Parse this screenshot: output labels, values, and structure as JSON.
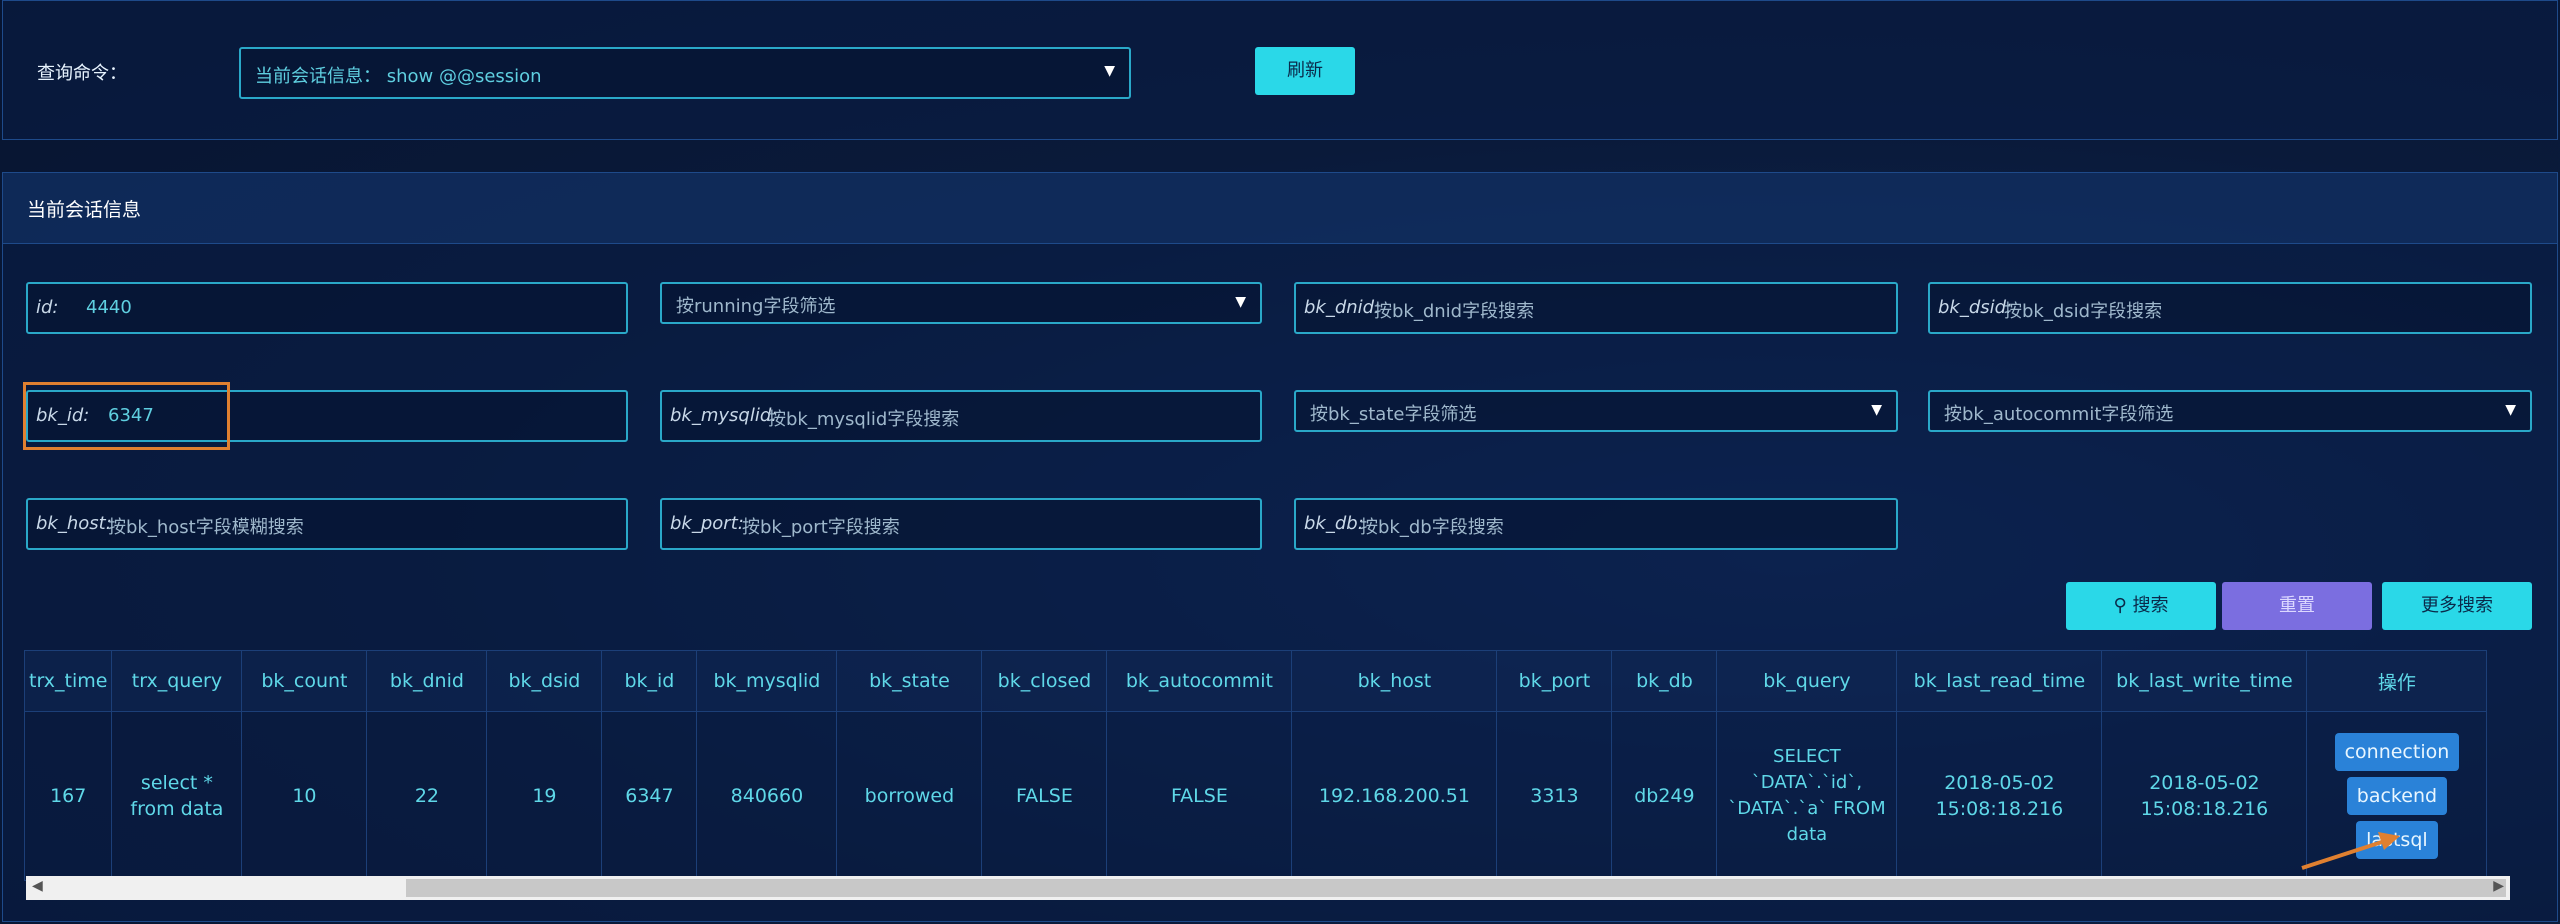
{
  "query": {
    "label": "查询命令：",
    "selected": "当前会话信息： show @@session",
    "refresh_label": "刷新"
  },
  "session": {
    "title": "当前会话信息",
    "filters": {
      "id": {
        "label": "id:",
        "value": "4440"
      },
      "running": {
        "placeholder": "按running字段筛选"
      },
      "bk_dnid": {
        "label": "bk_dnid:",
        "placeholder": "按bk_dnid字段搜索"
      },
      "bk_dsid": {
        "label": "bk_dsid:",
        "placeholder": "按bk_dsid字段搜索"
      },
      "bk_id": {
        "label": "bk_id:",
        "value": "6347"
      },
      "bk_mysqlid": {
        "label": "bk_mysqlid:",
        "placeholder": "按bk_mysqlid字段搜索"
      },
      "bk_state": {
        "placeholder": "按bk_state字段筛选"
      },
      "bk_autocommit": {
        "placeholder": "按bk_autocommit字段筛选"
      },
      "bk_host": {
        "label": "bk_host:",
        "placeholder": "按bk_host字段模糊搜索"
      },
      "bk_port": {
        "label": "bk_port:",
        "placeholder": "按bk_port字段搜索"
      },
      "bk_db": {
        "label": "bk_db:",
        "placeholder": "按bk_db字段搜索"
      }
    },
    "buttons": {
      "search": "搜索",
      "reset": "重置",
      "more": "更多搜索"
    },
    "columns": [
      "trx_time",
      "trx_query",
      "bk_count",
      "bk_dnid",
      "bk_dsid",
      "bk_id",
      "bk_mysqlid",
      "bk_state",
      "bk_closed",
      "bk_autocommit",
      "bk_host",
      "bk_port",
      "bk_db",
      "bk_query",
      "bk_last_read_time",
      "bk_last_write_time",
      "操作"
    ],
    "row": {
      "trx_time": "167",
      "trx_query": "select * from data",
      "bk_count": "10",
      "bk_dnid": "22",
      "bk_dsid": "19",
      "bk_id": "6347",
      "bk_mysqlid": "840660",
      "bk_state": "borrowed",
      "bk_closed": "FALSE",
      "bk_autocommit": "FALSE",
      "bk_host": "192.168.200.51",
      "bk_port": "3313",
      "bk_db": "db249",
      "bk_query": "SELECT `DATA`.`id`, `DATA`.`a` FROM data",
      "bk_last_read_time": "2018-05-02 15:08:18.216",
      "bk_last_write_time": "2018-05-02 15:08:18.216"
    },
    "ops": {
      "connection": "connection",
      "backend": "backend",
      "lastsql": "lastsql"
    }
  },
  "colors": {
    "accent": "#2ad8e8",
    "purple": "#7b6ee0",
    "highlight": "#e08030",
    "op_button": "#2a82d8"
  }
}
